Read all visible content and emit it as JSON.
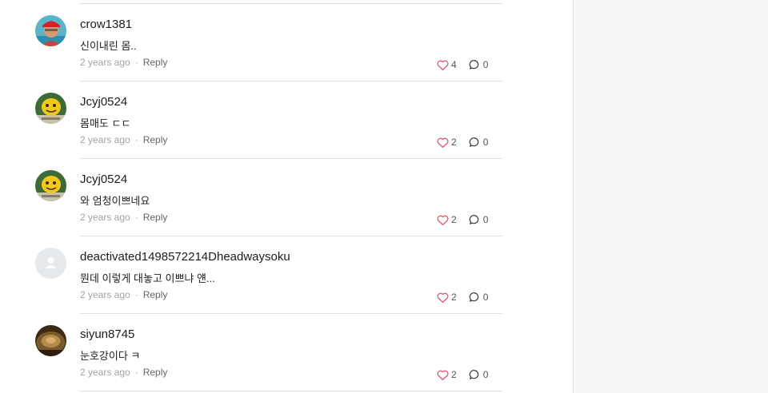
{
  "comments": [
    {
      "username": "crow1381",
      "text": "신이내린 몸..",
      "time": "2 years ago",
      "separator": "·",
      "reply_label": "Reply",
      "likes": "4",
      "replies": "0",
      "avatar": "avatar-photo-person"
    },
    {
      "username": "Jcyj0524",
      "text": "몸매도 ㄷㄷ",
      "time": "2 years ago",
      "separator": "·",
      "reply_label": "Reply",
      "likes": "2",
      "replies": "0",
      "avatar": "avatar-yellow-character"
    },
    {
      "username": "Jcyj0524",
      "text": "와 엄청이쁘네요",
      "time": "2 years ago",
      "separator": "·",
      "reply_label": "Reply",
      "likes": "2",
      "replies": "0",
      "avatar": "avatar-yellow-character"
    },
    {
      "username": "deactivated1498572214Dheadwaysoku",
      "text": "뭔데 이렇게 대놓고 이쁘냐 얜...",
      "time": "2 years ago",
      "separator": "·",
      "reply_label": "Reply",
      "likes": "2",
      "replies": "0",
      "avatar": "avatar-default-user"
    },
    {
      "username": "siyun8745",
      "text": "눈호강이다 ㅋ",
      "time": "2 years ago",
      "separator": "·",
      "reply_label": "Reply",
      "likes": "2",
      "replies": "0",
      "avatar": "avatar-photo-brown"
    }
  ],
  "colors": {
    "heart": "#e0506e",
    "divider": "#e2e2e2",
    "sidebar_bg": "#f8f8f8",
    "muted_text": "#a3a3a3"
  },
  "icons": {
    "like": "heart-outline-icon",
    "reply": "speech-bubble-icon"
  }
}
